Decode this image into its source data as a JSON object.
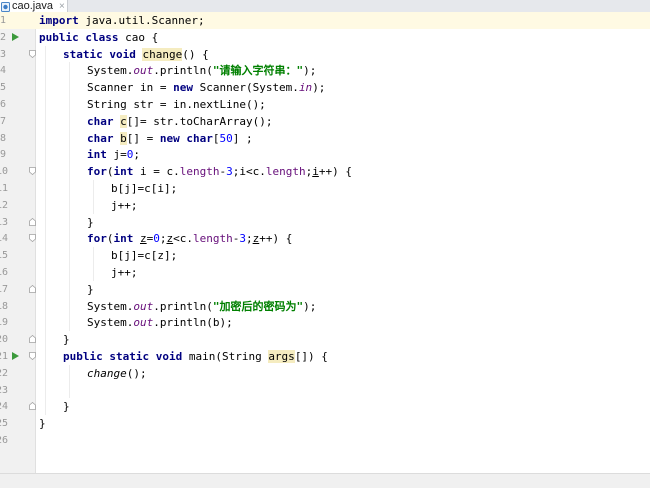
{
  "tab": {
    "title": "cao.java",
    "close_glyph": "×",
    "icon": "java-file-icon"
  },
  "lines": [
    {
      "n": "1",
      "run": false,
      "fold": "",
      "indent": 0,
      "tokens": [
        {
          "t": "import",
          "k": "kw"
        },
        {
          "t": " java.util.Scanner;",
          "k": "plain"
        }
      ]
    },
    {
      "n": "2",
      "run": true,
      "fold": "",
      "indent": 0,
      "tokens": [
        {
          "t": "public class",
          "k": "kw"
        },
        {
          "t": " cao {",
          "k": "plain"
        }
      ]
    },
    {
      "n": "3",
      "run": false,
      "fold": "open",
      "indent": 1,
      "tokens": [
        {
          "t": "static void",
          "k": "kw"
        },
        {
          "t": " ",
          "k": "plain"
        },
        {
          "t": "change",
          "k": "hl"
        },
        {
          "t": "() {",
          "k": "plain"
        }
      ]
    },
    {
      "n": "4",
      "run": false,
      "fold": "",
      "indent": 2,
      "tokens": [
        {
          "t": "System.",
          "k": "plain"
        },
        {
          "t": "out",
          "k": "field"
        },
        {
          "t": ".println(",
          "k": "plain"
        },
        {
          "t": "\"请输入字符串：\"",
          "k": "str"
        },
        {
          "t": ");",
          "k": "plain"
        }
      ]
    },
    {
      "n": "5",
      "run": false,
      "fold": "",
      "indent": 2,
      "tokens": [
        {
          "t": "Scanner in = ",
          "k": "plain"
        },
        {
          "t": "new",
          "k": "kw"
        },
        {
          "t": " Scanner(System.",
          "k": "plain"
        },
        {
          "t": "in",
          "k": "field"
        },
        {
          "t": ");",
          "k": "plain"
        }
      ]
    },
    {
      "n": "6",
      "run": false,
      "fold": "",
      "indent": 2,
      "tokens": [
        {
          "t": "String str = in.nextLine();",
          "k": "plain"
        }
      ]
    },
    {
      "n": "7",
      "run": false,
      "fold": "",
      "indent": 2,
      "tokens": [
        {
          "t": "char",
          "k": "kw"
        },
        {
          "t": " ",
          "k": "plain"
        },
        {
          "t": "c",
          "k": "hl"
        },
        {
          "t": "[]= str.toCharArray();",
          "k": "plain"
        }
      ]
    },
    {
      "n": "8",
      "run": false,
      "fold": "",
      "indent": 2,
      "tokens": [
        {
          "t": "char",
          "k": "kw"
        },
        {
          "t": " ",
          "k": "plain"
        },
        {
          "t": "b",
          "k": "hl"
        },
        {
          "t": "[] = ",
          "k": "plain"
        },
        {
          "t": "new char",
          "k": "kw"
        },
        {
          "t": "[",
          "k": "plain"
        },
        {
          "t": "50",
          "k": "num"
        },
        {
          "t": "] ;",
          "k": "plain"
        }
      ]
    },
    {
      "n": "9",
      "run": false,
      "fold": "",
      "indent": 2,
      "tokens": [
        {
          "t": "int",
          "k": "kw"
        },
        {
          "t": " j=",
          "k": "plain"
        },
        {
          "t": "0",
          "k": "num"
        },
        {
          "t": ";",
          "k": "plain"
        }
      ]
    },
    {
      "n": "10",
      "run": false,
      "fold": "open",
      "indent": 2,
      "tokens": [
        {
          "t": "for",
          "k": "kw"
        },
        {
          "t": "(",
          "k": "plain"
        },
        {
          "t": "int",
          "k": "kw"
        },
        {
          "t": " i = c.",
          "k": "plain"
        },
        {
          "t": "length",
          "k": "member"
        },
        {
          "t": "-",
          "k": "plain"
        },
        {
          "t": "3",
          "k": "num"
        },
        {
          "t": ";i<c.",
          "k": "plain"
        },
        {
          "t": "length",
          "k": "member"
        },
        {
          "t": ";",
          "k": "plain"
        },
        {
          "t": "i",
          "k": "ul"
        },
        {
          "t": "++) {",
          "k": "plain"
        }
      ]
    },
    {
      "n": "11",
      "run": false,
      "fold": "",
      "indent": 3,
      "tokens": [
        {
          "t": "b[j]=c[i];",
          "k": "plain"
        }
      ]
    },
    {
      "n": "12",
      "run": false,
      "fold": "",
      "indent": 3,
      "tokens": [
        {
          "t": "j++;",
          "k": "plain"
        }
      ]
    },
    {
      "n": "13",
      "run": false,
      "fold": "close",
      "indent": 2,
      "tokens": [
        {
          "t": "}",
          "k": "plain"
        }
      ]
    },
    {
      "n": "14",
      "run": false,
      "fold": "open",
      "indent": 2,
      "tokens": [
        {
          "t": "for",
          "k": "kw"
        },
        {
          "t": "(",
          "k": "plain"
        },
        {
          "t": "int",
          "k": "kw"
        },
        {
          "t": " ",
          "k": "plain"
        },
        {
          "t": "z",
          "k": "ul"
        },
        {
          "t": "=",
          "k": "plain"
        },
        {
          "t": "0",
          "k": "num"
        },
        {
          "t": ";",
          "k": "plain"
        },
        {
          "t": "z",
          "k": "ul"
        },
        {
          "t": "<c.",
          "k": "plain"
        },
        {
          "t": "length",
          "k": "member"
        },
        {
          "t": "-",
          "k": "plain"
        },
        {
          "t": "3",
          "k": "num"
        },
        {
          "t": ";",
          "k": "plain"
        },
        {
          "t": "z",
          "k": "ul"
        },
        {
          "t": "++) {",
          "k": "plain"
        }
      ]
    },
    {
      "n": "15",
      "run": false,
      "fold": "",
      "indent": 3,
      "tokens": [
        {
          "t": "b[j]=c[z];",
          "k": "plain"
        }
      ]
    },
    {
      "n": "16",
      "run": false,
      "fold": "",
      "indent": 3,
      "tokens": [
        {
          "t": "j++;",
          "k": "plain"
        }
      ]
    },
    {
      "n": "17",
      "run": false,
      "fold": "close",
      "indent": 2,
      "tokens": [
        {
          "t": "}",
          "k": "plain"
        }
      ]
    },
    {
      "n": "18",
      "run": false,
      "fold": "",
      "indent": 2,
      "tokens": [
        {
          "t": "System.",
          "k": "plain"
        },
        {
          "t": "out",
          "k": "field"
        },
        {
          "t": ".println(",
          "k": "plain"
        },
        {
          "t": "\"加密后的密码为\"",
          "k": "str"
        },
        {
          "t": ");",
          "k": "plain"
        }
      ]
    },
    {
      "n": "19",
      "run": false,
      "fold": "",
      "indent": 2,
      "tokens": [
        {
          "t": "System.",
          "k": "plain"
        },
        {
          "t": "out",
          "k": "field"
        },
        {
          "t": ".println(b);",
          "k": "plain"
        }
      ]
    },
    {
      "n": "20",
      "run": false,
      "fold": "close",
      "indent": 1,
      "tokens": [
        {
          "t": "}",
          "k": "plain"
        }
      ]
    },
    {
      "n": "21",
      "run": true,
      "fold": "open",
      "indent": 1,
      "tokens": [
        {
          "t": "public static void",
          "k": "kw"
        },
        {
          "t": " main(String ",
          "k": "plain"
        },
        {
          "t": "args",
          "k": "hl"
        },
        {
          "t": "[]) {",
          "k": "plain"
        }
      ]
    },
    {
      "n": "22",
      "run": false,
      "fold": "",
      "indent": 2,
      "tokens": [
        {
          "t": "change",
          "k": "italic"
        },
        {
          "t": "();",
          "k": "plain"
        }
      ]
    },
    {
      "n": "23",
      "run": false,
      "fold": "",
      "indent": 0,
      "tokens": []
    },
    {
      "n": "24",
      "run": false,
      "fold": "close",
      "indent": 1,
      "tokens": [
        {
          "t": "}",
          "k": "plain"
        }
      ]
    },
    {
      "n": "25",
      "run": false,
      "fold": "",
      "indent": 0,
      "tokens": [
        {
          "t": "}",
          "k": "plain"
        }
      ]
    },
    {
      "n": "26",
      "run": false,
      "fold": "",
      "indent": 0,
      "tokens": []
    }
  ]
}
